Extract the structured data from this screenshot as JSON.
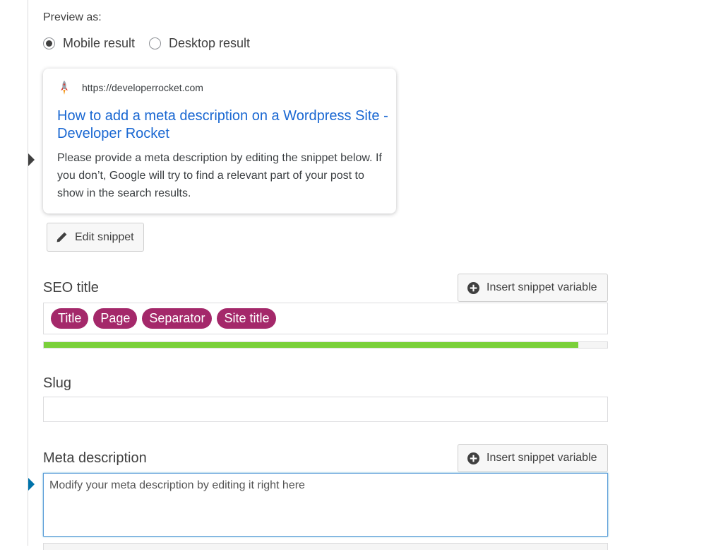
{
  "preview": {
    "label": "Preview as:",
    "options": [
      {
        "label": "Mobile result",
        "checked": true
      },
      {
        "label": "Desktop result",
        "checked": false
      }
    ]
  },
  "serp": {
    "url": "https://developerrocket.com",
    "favicon": "rocket-icon",
    "title": "How to add a meta description on a Wordpress Site - Developer Rocket",
    "description": "Please provide a meta description by editing the snippet below. If you don’t, Google will try to find a relevant part of your post to show in the search results."
  },
  "edit_snippet": {
    "label": "Edit snippet",
    "icon": "pencil-icon"
  },
  "seo_title": {
    "label": "SEO title",
    "insert_label": "Insert snippet variable",
    "variables": [
      "Title",
      "Page",
      "Separator",
      "Site title"
    ],
    "progress_percent": 94.8
  },
  "slug": {
    "label": "Slug",
    "value": ""
  },
  "meta_description": {
    "label": "Meta description",
    "insert_label": "Insert snippet variable",
    "value": "Modify your meta description by editing it right here"
  },
  "colors": {
    "pill": "#a4286a",
    "progress": "#7ad03a",
    "serp_title": "#1967d2",
    "focus_border": "#5b9dd9"
  }
}
